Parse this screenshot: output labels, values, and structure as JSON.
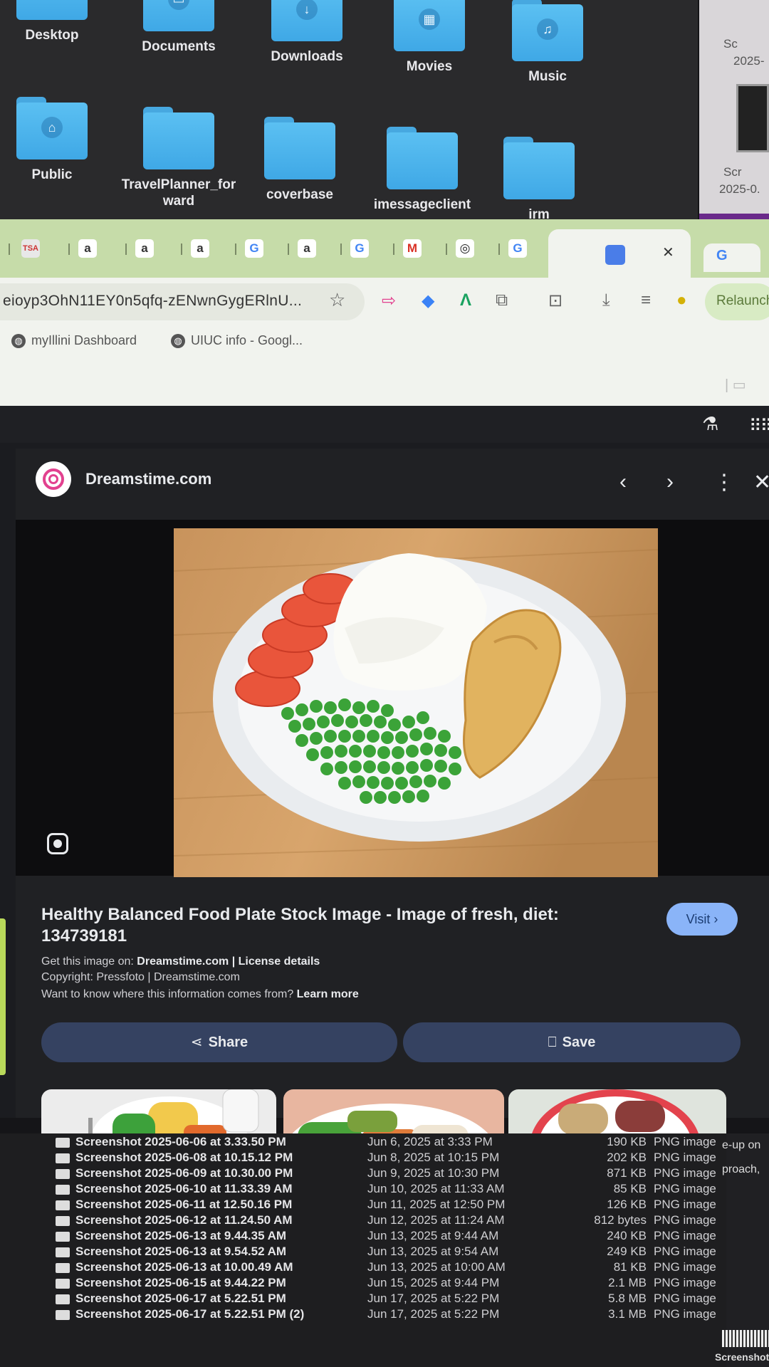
{
  "finder": {
    "folders_row1": [
      "Desktop",
      "Documents",
      "Downloads",
      "Movies",
      "Music"
    ],
    "folders_row2": [
      "Public",
      "TravelPlanner_for\nward",
      "coverbase",
      "imessageclient",
      "irm"
    ],
    "right_labels": [
      "Sc",
      "2025-",
      "Scr",
      "2025-0."
    ]
  },
  "chrome": {
    "url": "eioyp3OhN11EY0n5qfq-zENwnGygERlnU...",
    "relaunch_label": "Relaunch",
    "bookmarks": [
      "myIllini Dashboard",
      "UIUC info - Googl..."
    ]
  },
  "viewer": {
    "source_name": "Dreamstime.com",
    "title": "Healthy Balanced Food Plate Stock Image - Image of fresh, diet: 134739181",
    "visit_label": "Visit ›",
    "get_image_prefix": "Get this image on: ",
    "get_image_links": "Dreamstime.com | License details",
    "copyright": "Copyright: Pressfoto | Dreamstime.com",
    "info_question": "Want to know where this information comes from? ",
    "learn_more": "Learn more",
    "share_label": "Share",
    "save_label": "Save"
  },
  "file_list": {
    "right_text": [
      "e-up on",
      "proach,"
    ],
    "bottom_label": "Screenshot",
    "rows": [
      {
        "name": "Screenshot 2025-06-06 at 3.33.50 PM",
        "date": "Jun 6, 2025 at 3:33 PM",
        "size": "190 KB",
        "kind": "PNG image"
      },
      {
        "name": "Screenshot 2025-06-08 at 10.15.12 PM",
        "date": "Jun 8, 2025 at 10:15 PM",
        "size": "202 KB",
        "kind": "PNG image"
      },
      {
        "name": "Screenshot 2025-06-09 at 10.30.00 PM",
        "date": "Jun 9, 2025 at 10:30 PM",
        "size": "871 KB",
        "kind": "PNG image"
      },
      {
        "name": "Screenshot 2025-06-10 at 11.33.39 AM",
        "date": "Jun 10, 2025 at 11:33 AM",
        "size": "85 KB",
        "kind": "PNG image"
      },
      {
        "name": "Screenshot 2025-06-11 at 12.50.16 PM",
        "date": "Jun 11, 2025 at 12:50 PM",
        "size": "126 KB",
        "kind": "PNG image"
      },
      {
        "name": "Screenshot 2025-06-12 at 11.24.50 AM",
        "date": "Jun 12, 2025 at 11:24 AM",
        "size": "812 bytes",
        "kind": "PNG image"
      },
      {
        "name": "Screenshot 2025-06-13 at 9.44.35 AM",
        "date": "Jun 13, 2025 at 9:44 AM",
        "size": "240 KB",
        "kind": "PNG image"
      },
      {
        "name": "Screenshot 2025-06-13 at 9.54.52 AM",
        "date": "Jun 13, 2025 at 9:54 AM",
        "size": "249 KB",
        "kind": "PNG image"
      },
      {
        "name": "Screenshot 2025-06-13 at 10.00.49 AM",
        "date": "Jun 13, 2025 at 10:00 AM",
        "size": "81 KB",
        "kind": "PNG image"
      },
      {
        "name": "Screenshot 2025-06-15 at 9.44.22 PM",
        "date": "Jun 15, 2025 at 9:44 PM",
        "size": "2.1 MB",
        "kind": "PNG image"
      },
      {
        "name": "Screenshot 2025-06-17 at 5.22.51 PM",
        "date": "Jun 17, 2025 at 5:22 PM",
        "size": "5.8 MB",
        "kind": "PNG image"
      },
      {
        "name": "Screenshot 2025-06-17 at 5.22.51 PM (2)",
        "date": "Jun 17, 2025 at 5:22 PM",
        "size": "3.1 MB",
        "kind": "PNG image"
      }
    ]
  }
}
